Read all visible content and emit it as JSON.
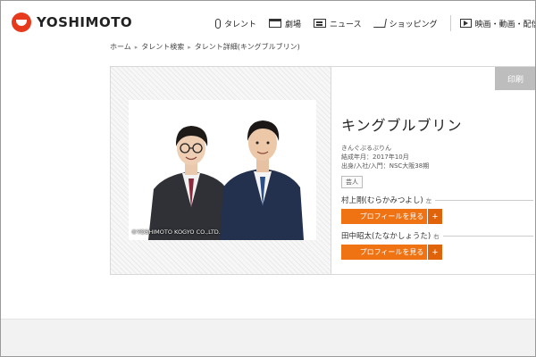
{
  "header": {
    "logo_text": "YOSHIMOTO",
    "nav": [
      {
        "label": "タレント",
        "icon": "microphone-icon"
      },
      {
        "label": "劇場",
        "icon": "stage-icon"
      },
      {
        "label": "ニュース",
        "icon": "news-icon"
      },
      {
        "label": "ショッピング",
        "icon": "cart-icon"
      },
      {
        "label": "映画・動画・配信",
        "icon": "video-icon"
      }
    ]
  },
  "breadcrumb": [
    "ホーム",
    "タレント検索",
    "タレント詳細(キングブルブリン)"
  ],
  "print_label": "印刷",
  "photo": {
    "copyright": "©YOSHIMOTO KOGYO CO.,LTD."
  },
  "talent": {
    "name": "キングブルブリン",
    "kana": "きんぐぶるぶりん",
    "formed": "結成年月：2017年10月",
    "origin": "出身/入社/入門：NSC大阪38期",
    "tag": "芸人",
    "members": [
      {
        "name": "村上剛(むらかみつよし)",
        "position": "左",
        "button": "プロフィールを見る",
        "plus": "+"
      },
      {
        "name": "田中昭太(たなかしょうた)",
        "position": "右",
        "button": "プロフィールを見る",
        "plus": "+"
      }
    ]
  },
  "colors": {
    "accent": "#f07313",
    "logo_red": "#e73a1d",
    "print_gray": "#bdbdbd"
  }
}
